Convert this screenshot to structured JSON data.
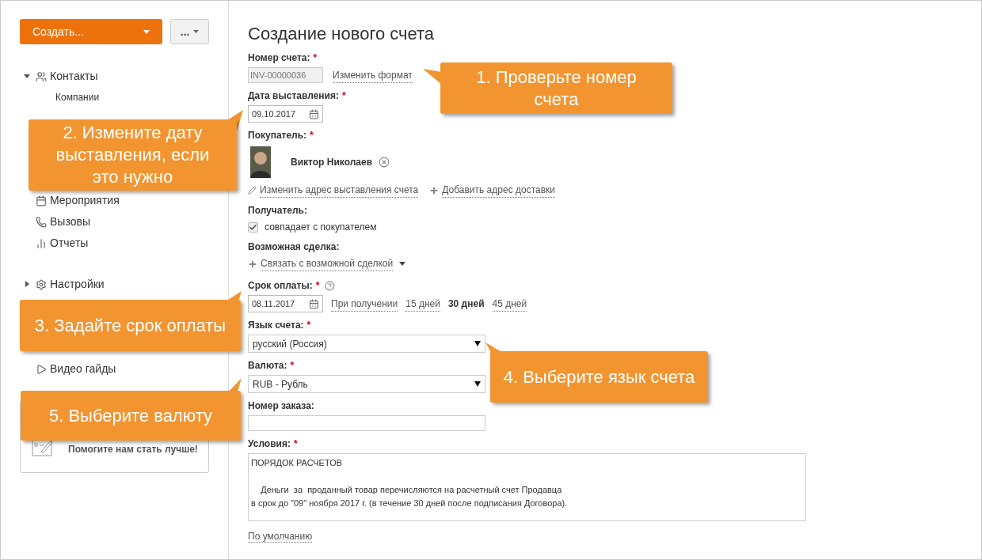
{
  "sidebar": {
    "create_button": "Создать...",
    "more_button": "...",
    "nav": [
      {
        "label": "Контакты",
        "kind": "group",
        "expanded": true,
        "children": [
          {
            "label": "Компании"
          }
        ]
      },
      {
        "label": "Мероприятия",
        "kind": "item"
      },
      {
        "label": "Вызовы",
        "kind": "item"
      },
      {
        "label": "Отчеты",
        "kind": "item"
      },
      {
        "label": "Настройки",
        "kind": "group",
        "expanded": false
      },
      {
        "label": "Видео гайды",
        "kind": "item"
      }
    ],
    "feedback": "Помогите нам стать лучше!"
  },
  "form": {
    "title": "Создание нового счета",
    "invoice_number": {
      "label": "Номер счета:",
      "required": "*",
      "value": "INV-00000036",
      "link": "Изменить формат"
    },
    "issue_date": {
      "label": "Дата выставления:",
      "required": "*",
      "value": "09.10.2017"
    },
    "buyer": {
      "label": "Покупатель:",
      "required": "*",
      "name": "Виктор Николаев",
      "links": [
        "Изменить адрес выставления счета",
        "Добавить адрес доставки"
      ]
    },
    "recipient": {
      "label": "Получатель:",
      "checkbox": "совпадает с покупателем",
      "checked": true
    },
    "deal": {
      "label": "Возможная сделка:",
      "link": "Связать с возможной сделкой"
    },
    "due": {
      "label": "Срок оплаты:",
      "required": "*",
      "value": "08.11.2017",
      "options": [
        {
          "label": "При получении",
          "selected": false
        },
        {
          "label": "15 дней",
          "selected": false
        },
        {
          "label": "30 дней",
          "selected": true
        },
        {
          "label": "45 дней",
          "selected": false
        }
      ]
    },
    "language": {
      "label": "Язык счета:",
      "required": "*",
      "value": "русский (Россия)"
    },
    "currency": {
      "label": "Валюта:",
      "required": "*",
      "value": "RUB - Рубль"
    },
    "order_number": {
      "label": "Номер заказа:"
    },
    "terms": {
      "label": "Условия:",
      "required": "*",
      "lines": [
        "ПОРЯДОК РАСЧЕТОВ",
        "    Деньги  за  проданный товар перечисляются на расчетный счет Продавца",
        "в срок до \"09\" ноября 2017 г. (в течение 30 дней после подписания Договора)."
      ],
      "default_link": "По умолчанию"
    }
  },
  "callouts": [
    {
      "text": "1. Проверьте номер счета"
    },
    {
      "text": "2. Измените дату выставления, если это нужно"
    },
    {
      "text": "3. Задайте срок оплаты"
    },
    {
      "text": "4. Выберите язык счета"
    },
    {
      "text": "5. Выберите валюту"
    }
  ]
}
